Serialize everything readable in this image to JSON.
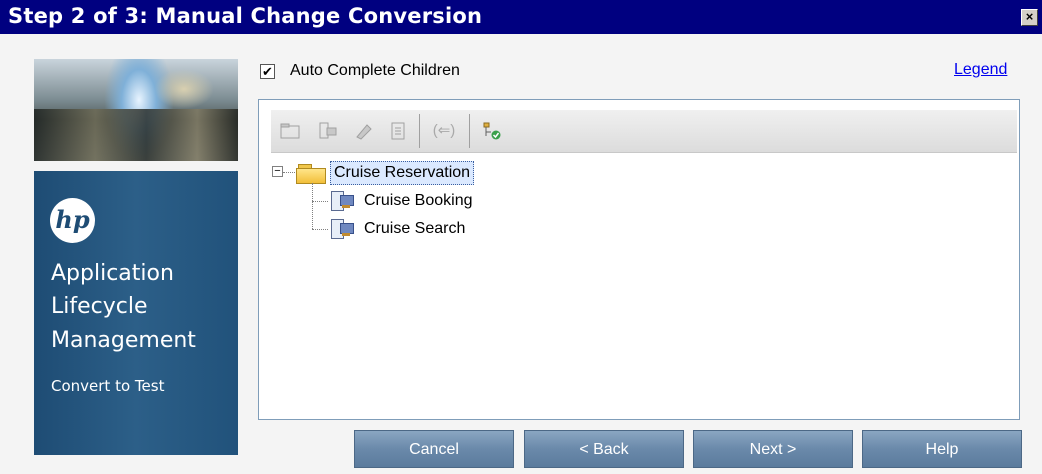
{
  "window": {
    "title": "Step 2 of 3: Manual Change Conversion",
    "close_glyph": "×"
  },
  "branding": {
    "logo_text": "hp",
    "product_lines": [
      "Application",
      "Lifecycle",
      "Management"
    ],
    "subtitle": "Convert to Test",
    "panel_color": "#2c5f88"
  },
  "options": {
    "auto_complete_children": {
      "label": "Auto Complete Children",
      "checked": true,
      "check_glyph": "✔"
    },
    "legend_link": "Legend"
  },
  "toolbar": {
    "icons": [
      "folder-icon",
      "test-icon",
      "eraser-icon",
      "document-icon",
      "convert-arrow-icon",
      "tree-check-icon"
    ],
    "convert_glyph": "(⇐)"
  },
  "tree": {
    "root": {
      "label": "Cruise Reservation",
      "expanded": true,
      "expander_glyph": "−",
      "children": [
        {
          "label": "Cruise Booking"
        },
        {
          "label": "Cruise Search"
        }
      ]
    }
  },
  "buttons": {
    "cancel": "Cancel",
    "back": "< Back",
    "next": "Next >",
    "help": "Help"
  }
}
